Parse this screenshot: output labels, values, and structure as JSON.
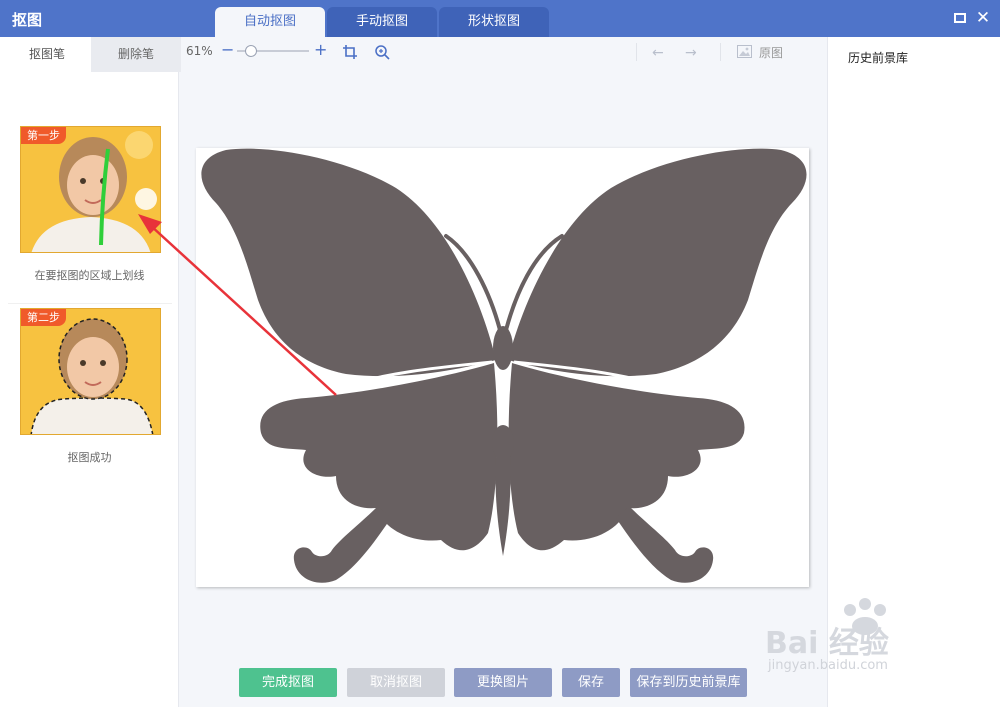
{
  "app": {
    "title": "抠图"
  },
  "tabs": [
    {
      "label": "自动抠图",
      "active": true
    },
    {
      "label": "手动抠图",
      "active": false
    },
    {
      "label": "形状抠图",
      "active": false
    }
  ],
  "left_panel": {
    "pen_tabs": [
      "抠图笔",
      "删除笔"
    ],
    "steps": [
      {
        "badge": "第一步",
        "caption": "在要抠图的区域上划线"
      },
      {
        "badge": "第二步",
        "caption": "抠图成功"
      }
    ]
  },
  "toolbar": {
    "zoom_percent": "61%",
    "zoom_minus": "−",
    "zoom_plus": "+",
    "zoom_level": 0.2,
    "original_label": "原图"
  },
  "right_panel": {
    "title": "历史前景库"
  },
  "watermark": {
    "main": "Bai 经验",
    "sub": "jingyan.baidu.com"
  },
  "buttons": {
    "done": "完成抠图",
    "cancel": "取消抠图",
    "replace": "更换图片",
    "save": "保存",
    "save_history": "保存到历史前景库"
  },
  "colors": {
    "title_bar": "#4f74c9",
    "butterfly": "#686061",
    "done_button": "#4ec28f",
    "arrow": "#e8333a",
    "stroke": "#3ccf3c"
  }
}
